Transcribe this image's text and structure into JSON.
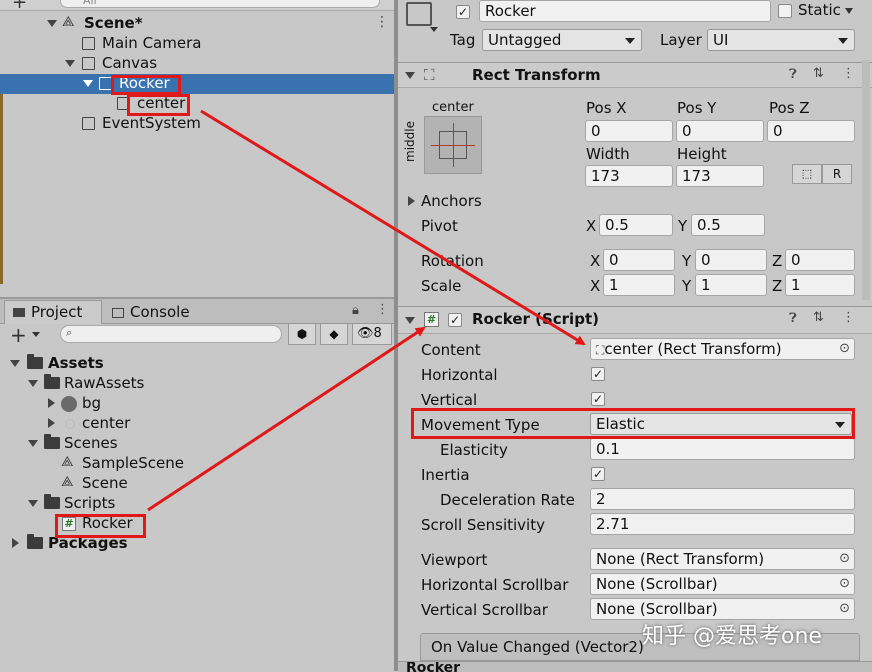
{
  "hierarchy": {
    "search_placeholder": "All",
    "scene_label": "Scene*",
    "items": [
      {
        "label": "Main Camera"
      },
      {
        "label": "Canvas"
      },
      {
        "label": "Rocker"
      },
      {
        "label": "center"
      },
      {
        "label": "EventSystem"
      }
    ]
  },
  "project": {
    "tab_project": "Project",
    "tab_console": "Console",
    "hidden_count": "8",
    "tree": {
      "assets": "Assets",
      "rawassets": "RawAssets",
      "bg": "bg",
      "center": "center",
      "scenes": "Scenes",
      "samplescene": "SampleScene",
      "scene": "Scene",
      "scripts": "Scripts",
      "rocker": "Rocker",
      "packages": "Packages"
    }
  },
  "inspector": {
    "object_name": "Rocker",
    "static_label": "Static",
    "tag_label": "Tag",
    "tag_value": "Untagged",
    "layer_label": "Layer",
    "layer_value": "UI",
    "rect_transform": {
      "title": "Rect Transform",
      "anchor_top": "center",
      "anchor_side": "middle",
      "posx_label": "Pos X",
      "posy_label": "Pos Y",
      "posz_label": "Pos Z",
      "posx": "0",
      "posy": "0",
      "posz": "0",
      "width_label": "Width",
      "height_label": "Height",
      "width": "173",
      "height": "173",
      "r_label": "R",
      "anchors_label": "Anchors",
      "pivot_label": "Pivot",
      "pivot_x": "0.5",
      "pivot_y": "0.5",
      "rotation_label": "Rotation",
      "rot_x": "0",
      "rot_y": "0",
      "rot_z": "0",
      "scale_label": "Scale",
      "scale_x": "1",
      "scale_y": "1",
      "scale_z": "1",
      "x": "X",
      "y": "Y",
      "z": "Z"
    },
    "script": {
      "title": "Rocker (Script)",
      "content_label": "Content",
      "content_value": "center (Rect Transform)",
      "horizontal_label": "Horizontal",
      "vertical_label": "Vertical",
      "movement_label": "Movement Type",
      "movement_value": "Elastic",
      "elasticity_label": "Elasticity",
      "elasticity_value": "0.1",
      "inertia_label": "Inertia",
      "decel_label": "Deceleration Rate",
      "decel_value": "2",
      "scroll_label": "Scroll Sensitivity",
      "scroll_value": "2.71",
      "viewport_label": "Viewport",
      "viewport_value": "None (Rect Transform)",
      "hscroll_label": "Horizontal Scrollbar",
      "hscroll_value": "None (Scrollbar)",
      "vscroll_label": "Vertical Scrollbar",
      "vscroll_value": "None (Scrollbar)",
      "onvalue_label": "On Value Changed (Vector2)",
      "bottom_cut": "Rocker"
    }
  },
  "watermark": "知乎 @爱思考one",
  "colors": {
    "selection": "#3a72b0",
    "annotation_red": "#e01818"
  }
}
